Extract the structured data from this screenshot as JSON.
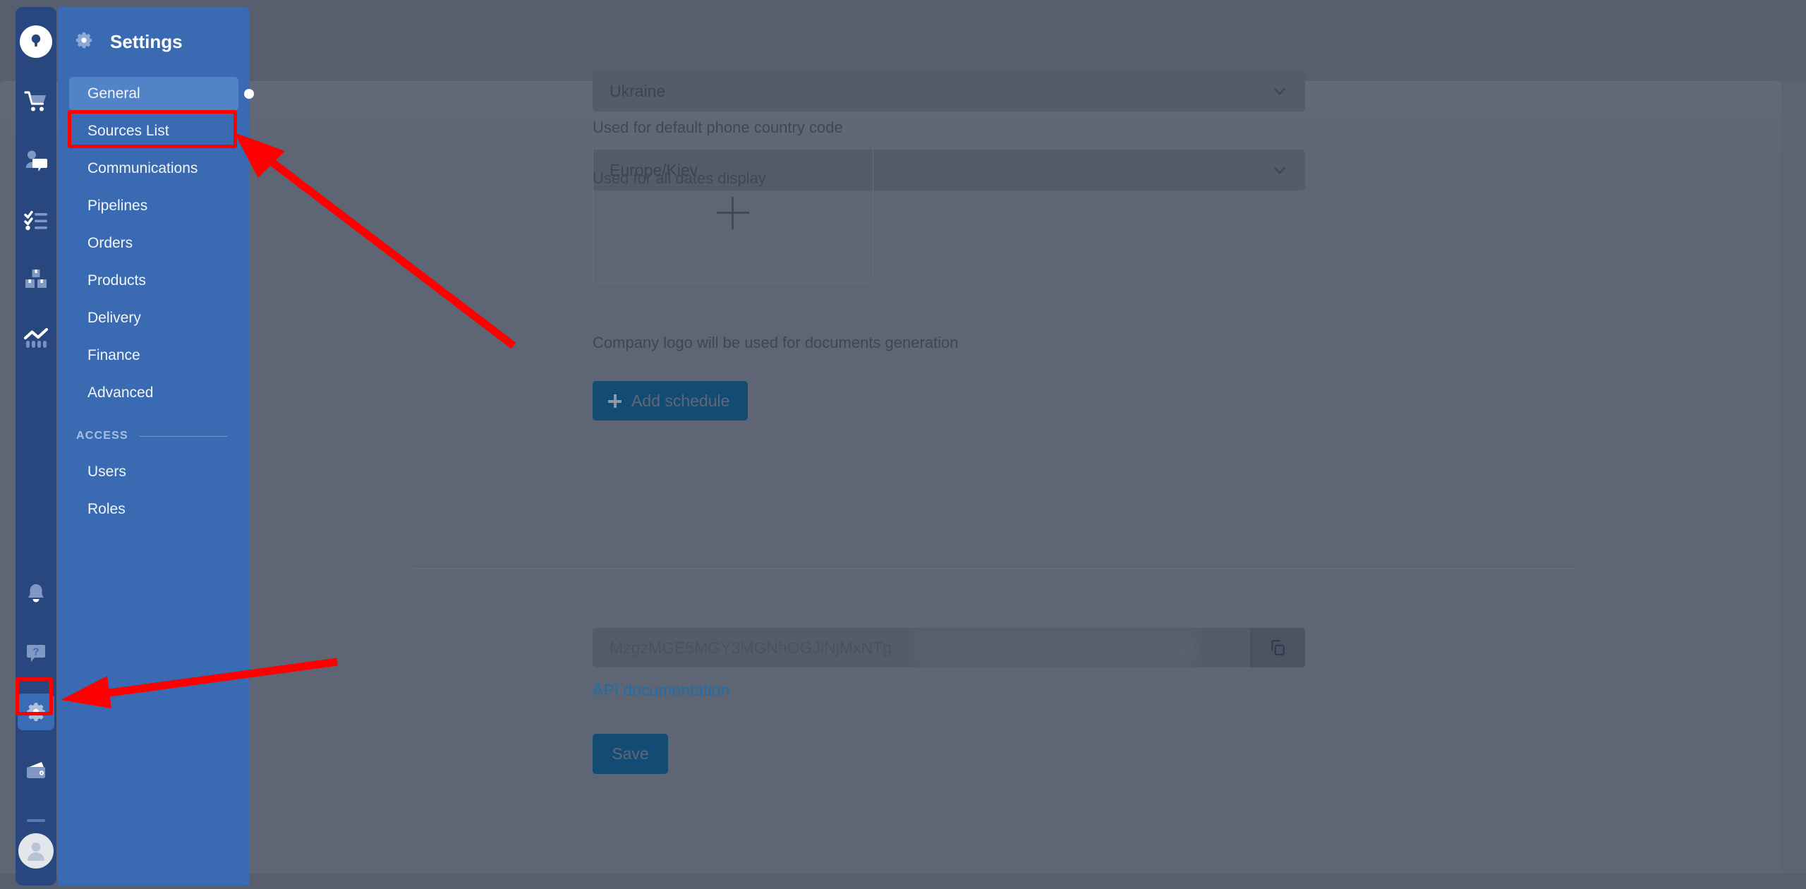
{
  "app": {
    "brand_icon": "lock-keyhole-icon",
    "rail_icons": [
      {
        "name": "cart-icon",
        "label": "Orders"
      },
      {
        "name": "chat-contact-icon",
        "label": "Communications"
      },
      {
        "name": "checklist-icon",
        "label": "Tasks"
      },
      {
        "name": "boxes-icon",
        "label": "Products"
      },
      {
        "name": "analytics-chart-icon",
        "label": "Analytics"
      }
    ],
    "rail_bottom_icons": [
      {
        "name": "bell-icon",
        "label": "Notifications"
      },
      {
        "name": "help-bubble-icon",
        "label": "Help"
      },
      {
        "name": "gear-icon",
        "label": "Settings"
      },
      {
        "name": "wallet-icon",
        "label": "Finance"
      }
    ],
    "avatar": "user-avatar"
  },
  "settings": {
    "title": "Settings",
    "header_icon": "gear-icon",
    "menu": [
      {
        "label": "General",
        "selected": true
      },
      {
        "label": "Sources List",
        "selected": false
      },
      {
        "label": "Communications",
        "selected": false
      },
      {
        "label": "Pipelines",
        "selected": false
      },
      {
        "label": "Orders",
        "selected": false
      },
      {
        "label": "Products",
        "selected": false
      },
      {
        "label": "Delivery",
        "selected": false
      },
      {
        "label": "Finance",
        "selected": false
      },
      {
        "label": "Advanced",
        "selected": false
      }
    ],
    "access_section_label": "ACCESS",
    "access_menu": [
      {
        "label": "Users",
        "selected": false
      },
      {
        "label": "Roles",
        "selected": false
      }
    ]
  },
  "form": {
    "country": {
      "value": "Ukraine",
      "help": "Used for default phone country code",
      "chevron_icon": "chevron-down-icon"
    },
    "timezone": {
      "value": "Europe/Kiev",
      "help": "Used for all dates display",
      "chevron_icon": "chevron-down-icon"
    },
    "logo": {
      "upload_icon": "plus-icon",
      "help": "Company logo will be used for documents generation"
    },
    "add_schedule_label": "Add schedule",
    "add_schedule_icon": "plus-icon",
    "api_key": {
      "value": "MzgzMGE5MGY3MGNhOGJiNjMxNTg",
      "copy_icon": "copy-icon"
    },
    "api_doc_link": "API documentation",
    "save_label": "Save"
  },
  "annotations": {
    "highlight_general": "red-rectangle-general",
    "highlight_gear": "red-rectangle-gear",
    "arrow_to_general": "red-arrow",
    "arrow_to_gear": "red-arrow"
  },
  "colors": {
    "rail_blue": "#28477f",
    "panel_blue": "#3a6ab2",
    "selected_blue": "#5183c9",
    "primary_button": "#124b73",
    "link_blue": "#1e6ea8",
    "annotation_red": "#fe0000",
    "backdrop": "#5c6373"
  }
}
